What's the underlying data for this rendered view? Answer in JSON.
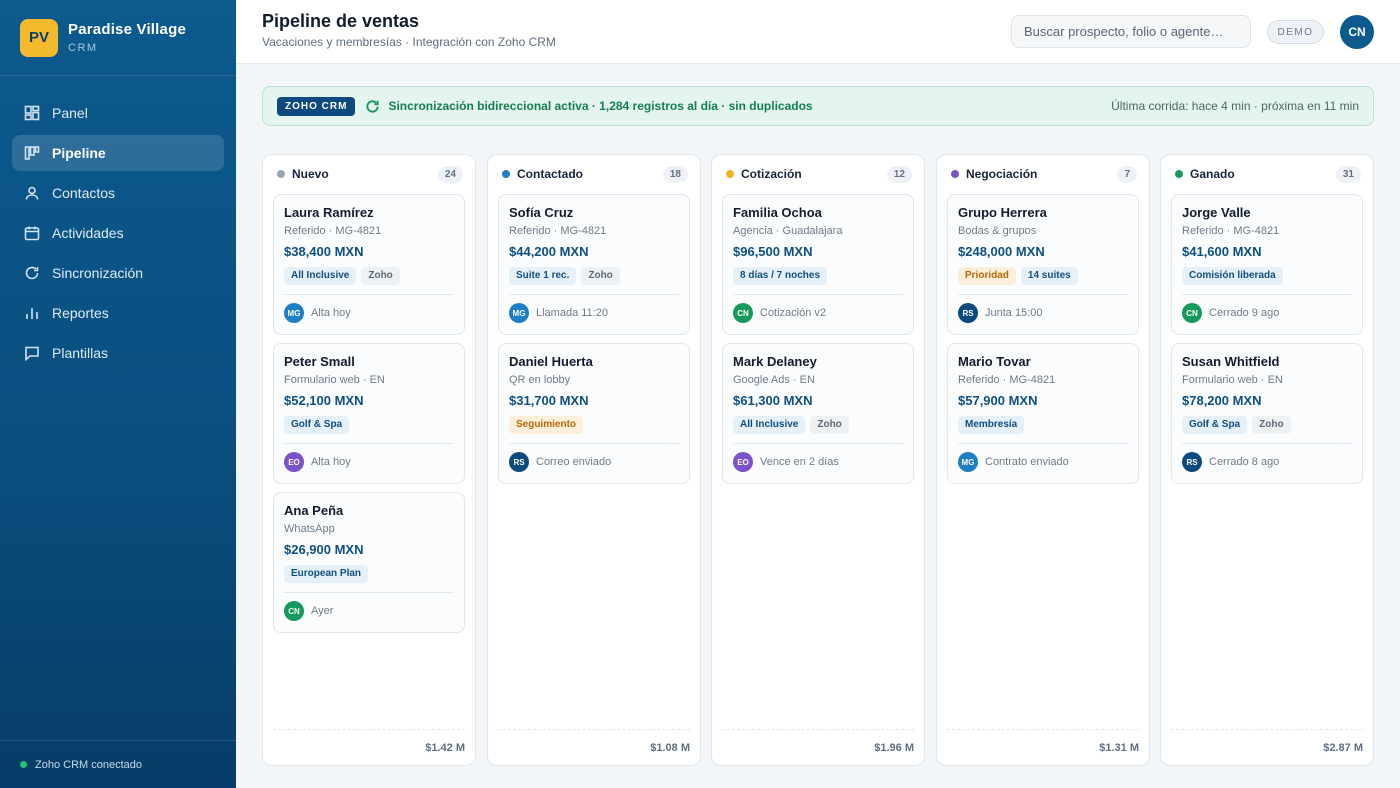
{
  "brand": {
    "logo": "PV",
    "name": "Paradise Village",
    "sub": "CRM"
  },
  "nav": [
    {
      "label": "Panel",
      "icon": "dashboard-icon"
    },
    {
      "label": "Pipeline",
      "icon": "pipeline-icon",
      "active": true
    },
    {
      "label": "Contactos",
      "icon": "user-icon"
    },
    {
      "label": "Actividades",
      "icon": "calendar-icon"
    },
    {
      "label": "Sincronización",
      "icon": "sync-icon"
    },
    {
      "label": "Reportes",
      "icon": "bar-chart-icon"
    },
    {
      "label": "Plantillas",
      "icon": "message-icon"
    }
  ],
  "sidebar_footer": "Zoho CRM conectado",
  "header": {
    "title": "Pipeline de ventas",
    "subtitle": "Vacaciones y membresías · Integración con Zoho CRM",
    "search_placeholder": "Buscar prospecto, folio o agente…",
    "badge": "DEMO",
    "user_initials": "CN"
  },
  "sync": {
    "badge": "ZOHO CRM",
    "status": "Sincronización bidireccional activa · 1,284 registros al día · sin duplicados",
    "meta": "Última corrida: hace 4 min · próxima en 11 min"
  },
  "colors": {
    "accent": "#0c5a8e",
    "agent_MG": "#1f7fc4",
    "agent_CN": "#159a5c",
    "agent_EO": "#7b52c9",
    "agent_RS": "#0b4a7c"
  },
  "columns": [
    {
      "title": "Nuevo",
      "count": "24",
      "dot": "#9aa5b1",
      "total": "$1.42 M",
      "cards": [
        {
          "name": "Laura Ramírez",
          "source": "Referido · MG-4821",
          "amount": "$38,400 MXN",
          "tags": [
            {
              "text": "All Inclusive",
              "style": "blue"
            },
            {
              "text": "Zoho",
              "style": "gray"
            }
          ],
          "agent": "MG",
          "activity": "Alta hoy"
        },
        {
          "name": "Peter Small",
          "source": "Formulario web · EN",
          "amount": "$52,100 MXN",
          "tags": [
            {
              "text": "Golf & Spa",
              "style": "blue"
            }
          ],
          "agent": "EO",
          "activity": "Alta hoy"
        },
        {
          "name": "Ana Peña",
          "source": "WhatsApp",
          "amount": "$26,900 MXN",
          "tags": [
            {
              "text": "European Plan",
              "style": "blue"
            }
          ],
          "agent": "CN",
          "activity": "Ayer"
        }
      ]
    },
    {
      "title": "Contactado",
      "count": "18",
      "dot": "#1f7fc4",
      "total": "$1.08 M",
      "cards": [
        {
          "name": "Sofía Cruz",
          "source": "Referido · MG-4821",
          "amount": "$44,200 MXN",
          "tags": [
            {
              "text": "Suite 1 rec.",
              "style": "blue"
            },
            {
              "text": "Zoho",
              "style": "gray"
            }
          ],
          "agent": "MG",
          "activity": "Llamada 11:20"
        },
        {
          "name": "Daniel Huerta",
          "source": "QR en lobby",
          "amount": "$31,700 MXN",
          "tags": [
            {
              "text": "Seguimiento",
              "style": "amber"
            }
          ],
          "agent": "RS",
          "activity": "Correo enviado"
        }
      ]
    },
    {
      "title": "Cotización",
      "count": "12",
      "dot": "#f0b429",
      "total": "$1.96 M",
      "cards": [
        {
          "name": "Familia Ochoa",
          "source": "Agencia · Guadalajara",
          "amount": "$96,500 MXN",
          "tags": [
            {
              "text": "8 días / 7 noches",
              "style": "blue"
            }
          ],
          "agent": "CN",
          "activity": "Cotización v2"
        },
        {
          "name": "Mark Delaney",
          "source": "Google Ads · EN",
          "amount": "$61,300 MXN",
          "tags": [
            {
              "text": "All Inclusive",
              "style": "blue"
            },
            {
              "text": "Zoho",
              "style": "gray"
            }
          ],
          "agent": "EO",
          "activity": "Vence en 2 días"
        }
      ]
    },
    {
      "title": "Negociación",
      "count": "7",
      "dot": "#7b52c9",
      "total": "$1.31 M",
      "cards": [
        {
          "name": "Grupo Herrera",
          "source": "Bodas & grupos",
          "amount": "$248,000 MXN",
          "tags": [
            {
              "text": "Prioridad",
              "style": "amber"
            },
            {
              "text": "14 suites",
              "style": "blue"
            }
          ],
          "agent": "RS",
          "activity": "Junta 15:00"
        },
        {
          "name": "Mario Tovar",
          "source": "Referido · MG-4821",
          "amount": "$57,900 MXN",
          "tags": [
            {
              "text": "Membresía",
              "style": "blue"
            }
          ],
          "agent": "MG",
          "activity": "Contrato enviado"
        }
      ]
    },
    {
      "title": "Ganado",
      "count": "31",
      "dot": "#159a5c",
      "total": "$2.87 M",
      "cards": [
        {
          "name": "Jorge Valle",
          "source": "Referido · MG-4821",
          "amount": "$41,600 MXN",
          "tags": [
            {
              "text": "Comisión liberada",
              "style": "blue"
            }
          ],
          "agent": "CN",
          "activity": "Cerrado 9 ago"
        },
        {
          "name": "Susan Whitfield",
          "source": "Formulario web · EN",
          "amount": "$78,200 MXN",
          "tags": [
            {
              "text": "Golf & Spa",
              "style": "blue"
            },
            {
              "text": "Zoho",
              "style": "gray"
            }
          ],
          "agent": "RS",
          "activity": "Cerrado 8 ago"
        }
      ]
    }
  ]
}
